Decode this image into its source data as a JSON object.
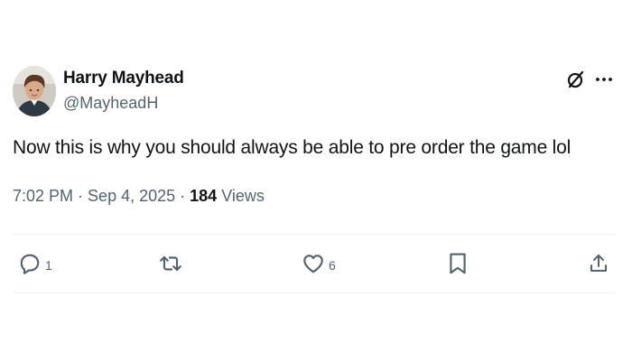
{
  "author": {
    "name": "Harry Mayhead",
    "handle": "@MayheadH"
  },
  "tweet": {
    "text": "Now this is why you should always be able to pre order the game lol"
  },
  "meta": {
    "time": "7:02 PM",
    "separator": " · ",
    "date": "Sep 4, 2025",
    "views_count": "184",
    "views_label": " Views"
  },
  "actions": {
    "reply_count": "1",
    "like_count": "6"
  },
  "icons": {
    "header": [
      "grok-icon",
      "more-icon"
    ],
    "actions": [
      "reply-icon",
      "repost-icon",
      "like-icon",
      "bookmark-icon",
      "share-icon"
    ]
  },
  "colors": {
    "text_primary": "#0f1419",
    "text_secondary": "#536471",
    "divider": "#eff3f4"
  }
}
